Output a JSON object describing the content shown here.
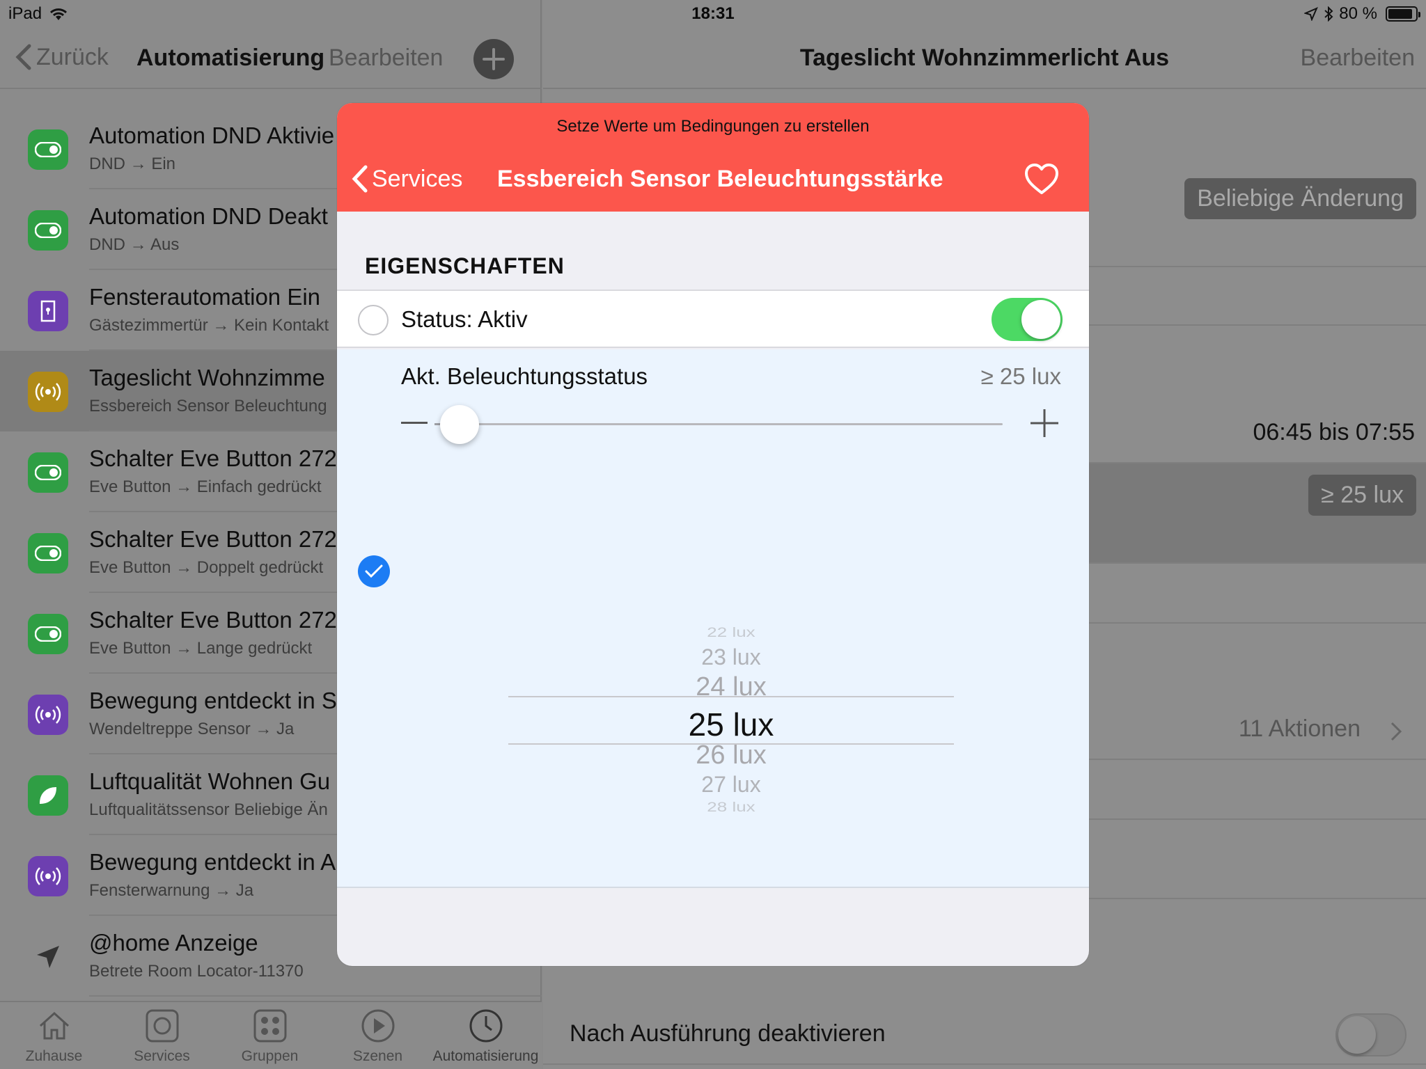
{
  "status_bar": {
    "device": "iPad",
    "time": "18:31",
    "battery": "80 %"
  },
  "left_nav": {
    "back_label": "Zurück",
    "title": "Automatisierung",
    "edit_label": "Bearbeiten"
  },
  "automations": [
    {
      "title": "Automation DND Aktivie",
      "subtitle": "DND → Ein",
      "icon": "switch-icon",
      "color": "#2f9e44"
    },
    {
      "title": "Automation DND Deakt",
      "subtitle": "DND → Aus",
      "icon": "switch-icon",
      "color": "#2f9e44"
    },
    {
      "title": "Fensterautomation Ein",
      "subtitle": "Gästezimmertür → Kein Kontakt",
      "icon": "door-icon",
      "color": "#6d3fb0"
    },
    {
      "title": "Tageslicht Wohnzimme",
      "subtitle": "Essbereich Sensor Beleuchtung",
      "icon": "sensor-icon",
      "color": "#b08a17"
    },
    {
      "title": "Schalter Eve Button 272",
      "subtitle": "Eve Button → Einfach gedrückt",
      "icon": "switch-icon",
      "color": "#2f9e44"
    },
    {
      "title": "Schalter Eve Button 272",
      "subtitle": "Eve Button → Doppelt gedrückt",
      "icon": "switch-icon",
      "color": "#2f9e44"
    },
    {
      "title": "Schalter Eve Button 272",
      "subtitle": "Eve Button → Lange gedrückt",
      "icon": "switch-icon",
      "color": "#2f9e44"
    },
    {
      "title": "Bewegung entdeckt in S",
      "subtitle": "Wendeltreppe Sensor → Ja",
      "icon": "sensor-icon",
      "color": "#6d3fb0"
    },
    {
      "title": "Luftqualität Wohnen Gu",
      "subtitle": "Luftqualitätssensor Beliebige Än",
      "icon": "leaf-icon",
      "color": "#2f9e44"
    },
    {
      "title": "Bewegung entdeckt in A",
      "subtitle": "Fensterwarnung → Ja",
      "icon": "sensor-icon",
      "color": "#6d3fb0"
    },
    {
      "title": "@home Anzeige",
      "subtitle": "Betrete Room Locator-11370",
      "icon": "location-arrow-icon",
      "color": ""
    }
  ],
  "tabs": [
    {
      "label": "Zuhause",
      "icon": "home-icon"
    },
    {
      "label": "Services",
      "icon": "services-icon"
    },
    {
      "label": "Gruppen",
      "icon": "groups-icon"
    },
    {
      "label": "Szenen",
      "icon": "play-icon"
    },
    {
      "label": "Automatisierung",
      "icon": "clock-icon"
    }
  ],
  "right_nav": {
    "title": "Tageslicht Wohnzimmerlicht Aus",
    "edit_label": "Bearbeiten"
  },
  "detail": {
    "trigger_chip": "Beliebige Änderung",
    "time_range": "06:45 bis 07:55",
    "lux_chip": "≥ 25 lux",
    "actions": "11 Aktionen",
    "deactivate_label": "Nach Ausführung deaktivieren",
    "deactivate_on": false
  },
  "modal": {
    "hint": "Setze Werte um Bedingungen zu erstellen",
    "back_label": "Services",
    "title": "Essbereich Sensor Beleuchtungsstärke",
    "section": "EIGENSCHAFTEN",
    "status_label": "Status: Aktiv",
    "status_on": true,
    "lux_label": "Akt. Beleuchtungsstatus",
    "lux_value": "≥ 25 lux",
    "slider_fraction": 0.02,
    "picker": [
      "22 lux",
      "23 lux",
      "24 lux",
      "25 lux",
      "26 lux",
      "27 lux",
      "28 lux"
    ],
    "picker_selected": "25 lux"
  },
  "colors": {
    "accent_red": "#fc564c",
    "toggle_green": "#4cd964",
    "check_blue": "#1c7cf4"
  }
}
